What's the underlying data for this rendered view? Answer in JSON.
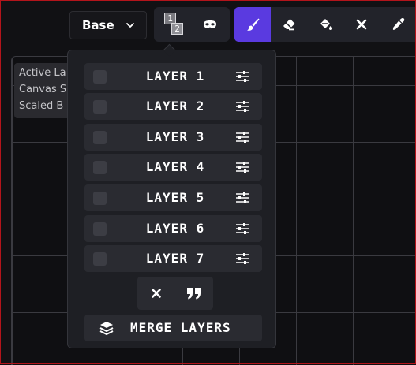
{
  "toolbar": {
    "base_select": {
      "label": "Base"
    },
    "layer_badges": [
      "1",
      "2"
    ],
    "tools": [
      {
        "name": "brush",
        "icon": "brush-icon",
        "active": true
      },
      {
        "name": "eraser",
        "icon": "eraser-icon",
        "active": false
      },
      {
        "name": "fill",
        "icon": "paint-bucket-icon",
        "active": false
      },
      {
        "name": "clear",
        "icon": "close-icon",
        "active": false
      },
      {
        "name": "color-picker",
        "icon": "eyedropper-icon",
        "active": false
      }
    ]
  },
  "info_panel": {
    "lines": [
      "Active La",
      "Canvas S",
      "Scaled B"
    ]
  },
  "layers": {
    "items": [
      {
        "label": "LAYER 1",
        "checked": false
      },
      {
        "label": "LAYER 2",
        "checked": false
      },
      {
        "label": "LAYER 3",
        "checked": false
      },
      {
        "label": "LAYER 4",
        "checked": false
      },
      {
        "label": "LAYER 5",
        "checked": false
      },
      {
        "label": "LAYER 6",
        "checked": false
      },
      {
        "label": "LAYER 7",
        "checked": false
      }
    ],
    "merge_label": "MERGE LAYERS"
  },
  "colors": {
    "accent": "#5a3ae0",
    "panel": "#1e1f24",
    "row": "#2a2b31",
    "canvas_border": "#b3141b"
  }
}
